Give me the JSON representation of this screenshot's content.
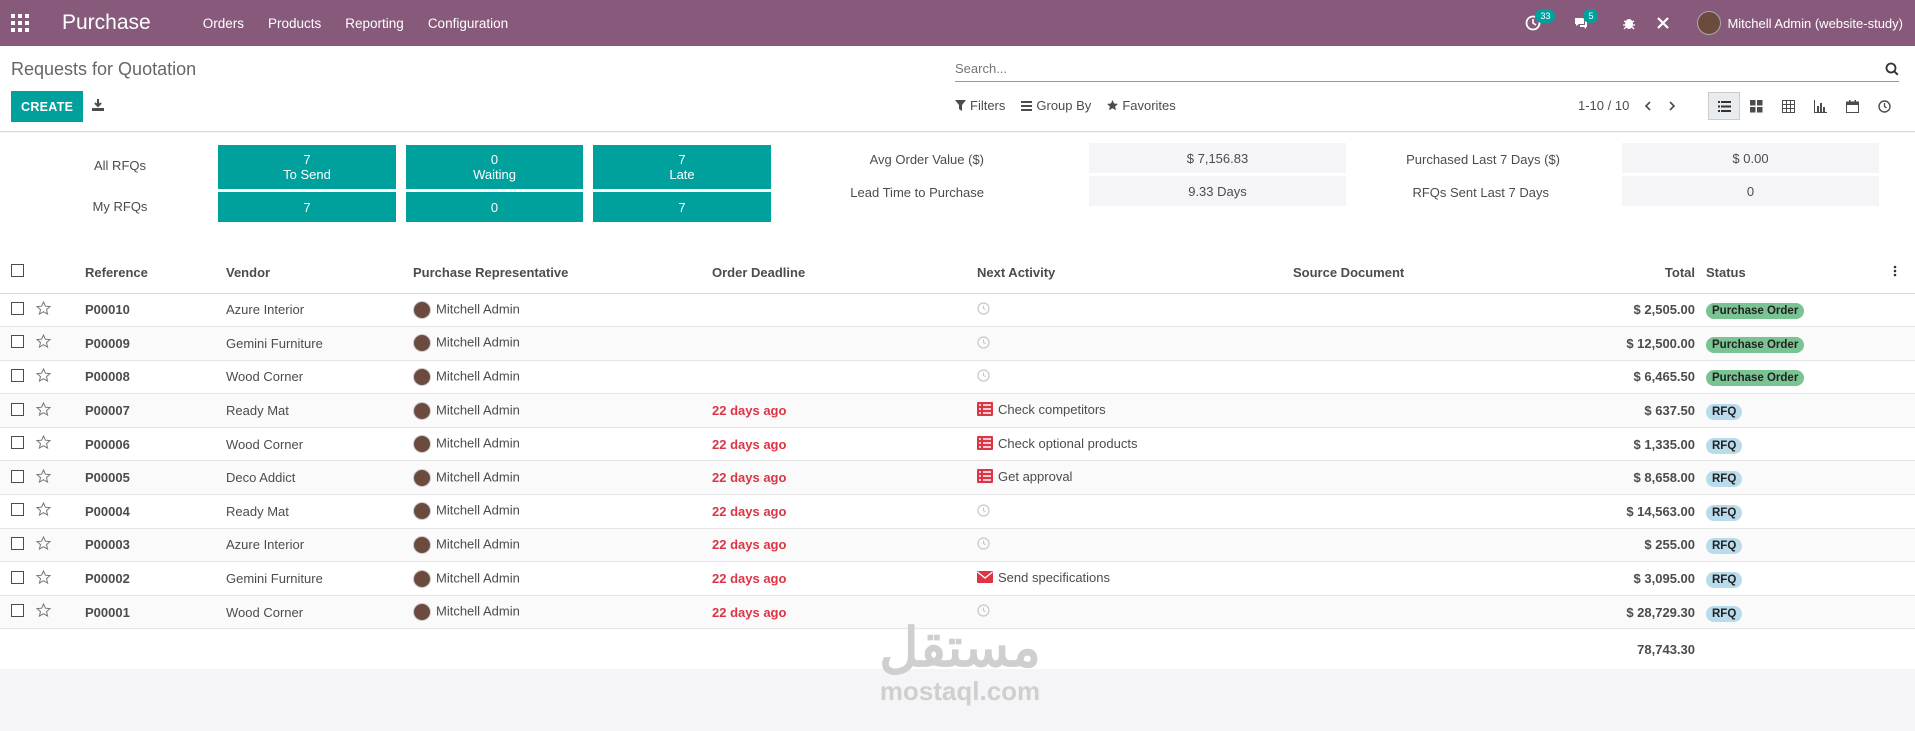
{
  "navbar": {
    "app_title": "Purchase",
    "menu": [
      "Orders",
      "Products",
      "Reporting",
      "Configuration"
    ],
    "activity_count": "33",
    "message_count": "5",
    "user_name": "Mitchell Admin (website-study)"
  },
  "control": {
    "breadcrumb": "Requests for Quotation",
    "create_label": "CREATE",
    "search_placeholder": "Search...",
    "filters_label": "Filters",
    "groupby_label": "Group By",
    "favorites_label": "Favorites",
    "pager": "1-10 / 10"
  },
  "dashboard": {
    "all_rfqs_label": "All RFQs",
    "my_rfqs_label": "My RFQs",
    "to_send": {
      "count": "7",
      "label": "To Send",
      "mine": "7"
    },
    "waiting": {
      "count": "0",
      "label": "Waiting",
      "mine": "0"
    },
    "late": {
      "count": "7",
      "label": "Late",
      "mine": "7"
    },
    "avg_order_label": "Avg Order Value ($)",
    "avg_order_value": "$ 7,156.83",
    "lead_time_label": "Lead Time to Purchase",
    "lead_time_value": "9.33  Days",
    "purchased_label": "Purchased Last 7 Days ($)",
    "purchased_value": "$ 0.00",
    "sent_label": "RFQs Sent Last 7 Days",
    "sent_value": "0"
  },
  "table": {
    "headers": {
      "reference": "Reference",
      "vendor": "Vendor",
      "rep": "Purchase Representative",
      "deadline": "Order Deadline",
      "activity": "Next Activity",
      "source": "Source Document",
      "total": "Total",
      "status": "Status"
    },
    "rows": [
      {
        "ref": "P00010",
        "vendor": "Azure Interior",
        "rep": "Mitchell Admin",
        "deadline": "",
        "activity": "",
        "activity_icon": "clock-icon",
        "total": "$ 2,505.00",
        "status": "Purchase Order"
      },
      {
        "ref": "P00009",
        "vendor": "Gemini Furniture",
        "rep": "Mitchell Admin",
        "deadline": "",
        "activity": "",
        "activity_icon": "clock-icon",
        "total": "$ 12,500.00",
        "status": "Purchase Order"
      },
      {
        "ref": "P00008",
        "vendor": "Wood Corner",
        "rep": "Mitchell Admin",
        "deadline": "",
        "activity": "",
        "activity_icon": "clock-icon",
        "total": "$ 6,465.50",
        "status": "Purchase Order"
      },
      {
        "ref": "P00007",
        "vendor": "Ready Mat",
        "rep": "Mitchell Admin",
        "deadline": "22 days ago",
        "activity": "Check competitors",
        "activity_icon": "list-icon",
        "total": "$ 637.50",
        "status": "RFQ"
      },
      {
        "ref": "P00006",
        "vendor": "Wood Corner",
        "rep": "Mitchell Admin",
        "deadline": "22 days ago",
        "activity": "Check optional products",
        "activity_icon": "list-icon",
        "total": "$ 1,335.00",
        "status": "RFQ"
      },
      {
        "ref": "P00005",
        "vendor": "Deco Addict",
        "rep": "Mitchell Admin",
        "deadline": "22 days ago",
        "activity": "Get approval",
        "activity_icon": "list-icon",
        "total": "$ 8,658.00",
        "status": "RFQ"
      },
      {
        "ref": "P00004",
        "vendor": "Ready Mat",
        "rep": "Mitchell Admin",
        "deadline": "22 days ago",
        "activity": "",
        "activity_icon": "clock-icon",
        "total": "$ 14,563.00",
        "status": "RFQ"
      },
      {
        "ref": "P00003",
        "vendor": "Azure Interior",
        "rep": "Mitchell Admin",
        "deadline": "22 days ago",
        "activity": "",
        "activity_icon": "clock-icon",
        "total": "$ 255.00",
        "status": "RFQ"
      },
      {
        "ref": "P00002",
        "vendor": "Gemini Furniture",
        "rep": "Mitchell Admin",
        "deadline": "22 days ago",
        "activity": "Send specifications",
        "activity_icon": "envelope-icon",
        "total": "$ 3,095.00",
        "status": "RFQ"
      },
      {
        "ref": "P00001",
        "vendor": "Wood Corner",
        "rep": "Mitchell Admin",
        "deadline": "22 days ago",
        "activity": "",
        "activity_icon": "clock-icon",
        "total": "$ 28,729.30",
        "status": "RFQ"
      }
    ],
    "sum_total": "78,743.30"
  },
  "watermark": {
    "arabic": "مستقل",
    "latin": "mostaql.com"
  }
}
